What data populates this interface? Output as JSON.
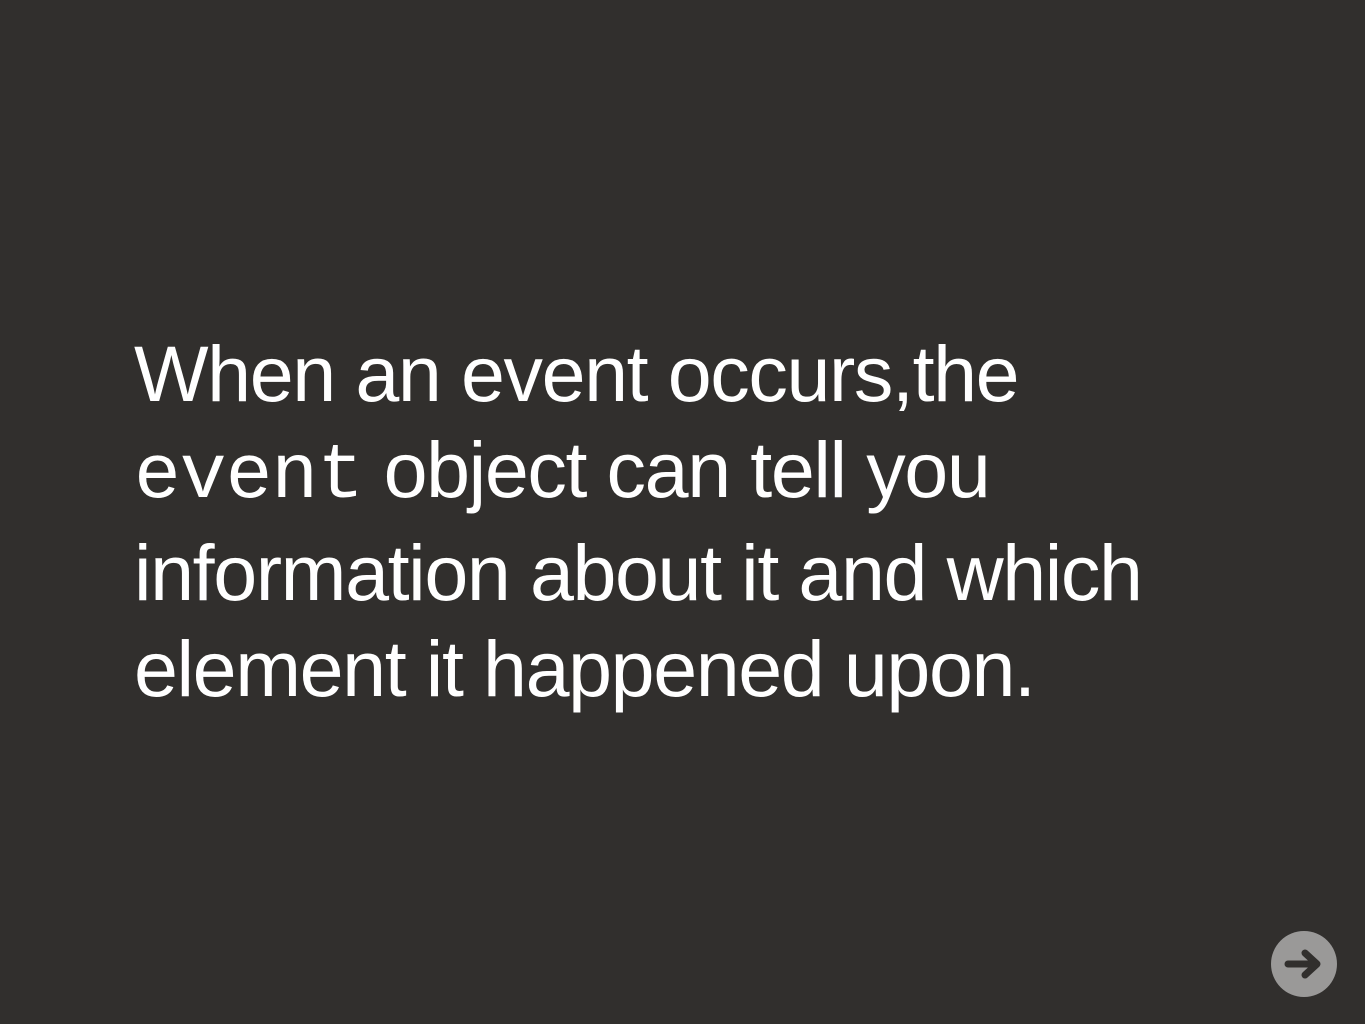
{
  "slide": {
    "text": {
      "line1": "When an event occurs,the",
      "line2_code": "event",
      "line2_rest": " object can tell you",
      "line3": "information about it and which",
      "line4": "element it happened upon."
    },
    "next_button": {
      "icon": "arrow-right-icon"
    }
  },
  "colors": {
    "background": "#312f2d",
    "text": "#ffffff",
    "button": "#9a9998",
    "arrow": "#312f2d"
  }
}
